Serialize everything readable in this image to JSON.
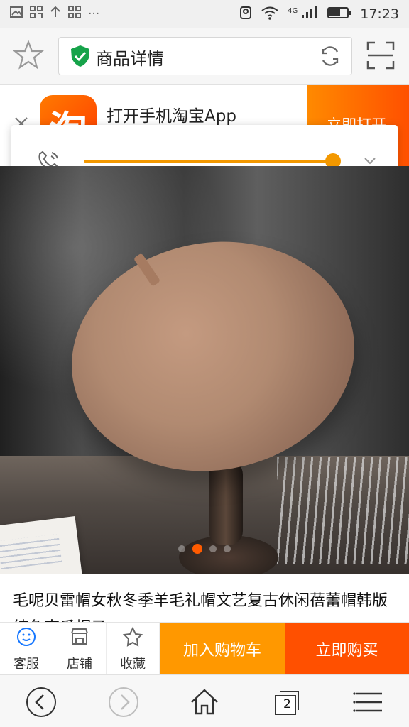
{
  "status_bar": {
    "time": "17:23",
    "network": "4G",
    "left_icons": [
      "image-icon",
      "app-icon",
      "upload-icon",
      "app-grid-icon",
      "more-dots-icon"
    ],
    "right_icons": [
      "location-icon",
      "wifi-icon",
      "signal-icon",
      "battery-icon"
    ],
    "more_symbol": "···"
  },
  "browser_bar": {
    "title": "商品详情",
    "icons": [
      "star-icon",
      "shield-check-icon",
      "refresh-icon",
      "fullscreen-icon"
    ]
  },
  "taobao_banner": {
    "logo_text": "淘",
    "message": "打开手机淘宝App",
    "button_label": "立即打开",
    "accent": "#ff5000"
  },
  "volume_control": {
    "level": 0.98,
    "accent": "#f39800"
  },
  "product_image": {
    "carousel_active_index": 1,
    "carousel_count": 4
  },
  "product": {
    "title": "毛呢贝雷帽女秋冬季羊毛礼帽文艺复古休闲蓓蕾帽韩版纯色南瓜帽子"
  },
  "action_bar": {
    "service_label": "客服",
    "store_label": "店铺",
    "favorite_label": "收藏",
    "add_to_cart_label": "加入购物车",
    "buy_now_label": "立即购买",
    "cart_color": "#ff9800",
    "buy_color": "#ff5000"
  },
  "bottom_nav": {
    "tab_count": "2",
    "icons": [
      "back-icon",
      "forward-icon",
      "home-icon",
      "tabs-icon",
      "menu-icon"
    ]
  }
}
